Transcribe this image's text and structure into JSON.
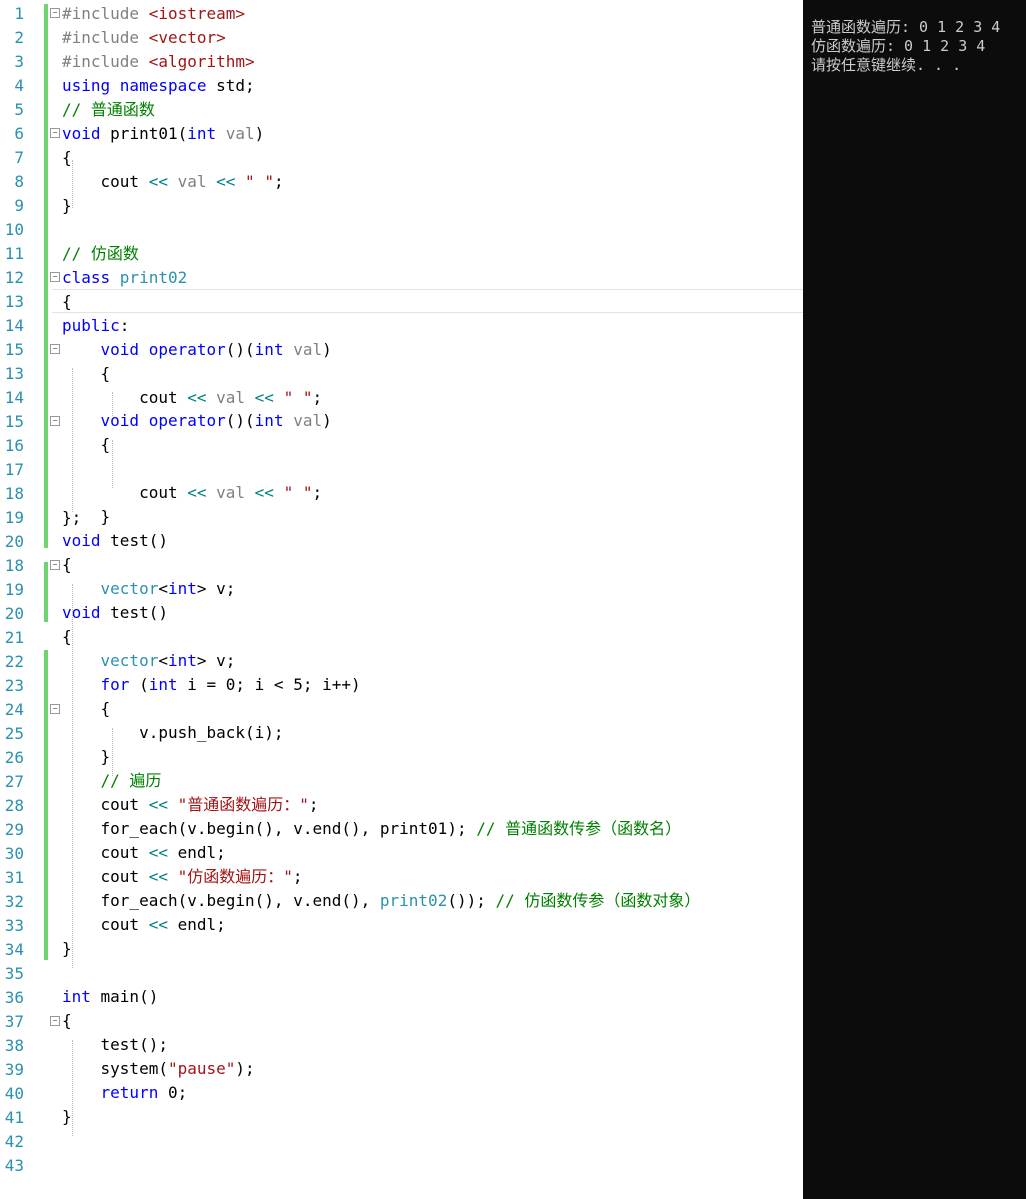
{
  "editor": {
    "lines": [
      {
        "n": "1",
        "segs": [
          {
            "t": "#include ",
            "c": "pp"
          },
          {
            "t": "<iostream>",
            "c": "str"
          }
        ]
      },
      {
        "n": "2",
        "segs": [
          {
            "t": "#include ",
            "c": "pp"
          },
          {
            "t": "<vector>",
            "c": "str"
          }
        ]
      },
      {
        "n": "3",
        "segs": [
          {
            "t": "#include ",
            "c": "pp"
          },
          {
            "t": "<algorithm>",
            "c": "str"
          }
        ]
      },
      {
        "n": "4",
        "segs": [
          {
            "t": "using namespace ",
            "c": "kw"
          },
          {
            "t": "std;",
            "c": ""
          }
        ]
      },
      {
        "n": "5",
        "segs": [
          {
            "t": "// 普通函数",
            "c": "cm"
          }
        ]
      },
      {
        "n": "6",
        "segs": [
          {
            "t": "void ",
            "c": "kw"
          },
          {
            "t": "print01(",
            "c": ""
          },
          {
            "t": "int ",
            "c": "kw"
          },
          {
            "t": "val",
            "c": "pa"
          },
          {
            "t": ")",
            "c": ""
          }
        ]
      },
      {
        "n": "7",
        "segs": [
          {
            "t": "{",
            "c": ""
          }
        ]
      },
      {
        "n": "8",
        "segs": [
          {
            "t": "    cout ",
            "c": ""
          },
          {
            "t": "<< ",
            "c": "op"
          },
          {
            "t": "val ",
            "c": "pa"
          },
          {
            "t": "<< ",
            "c": "op"
          },
          {
            "t": "\" \"",
            "c": "str"
          },
          {
            "t": ";",
            "c": ""
          }
        ]
      },
      {
        "n": "9",
        "segs": [
          {
            "t": "}",
            "c": ""
          }
        ]
      },
      {
        "n": "10",
        "segs": []
      },
      {
        "n": "11",
        "segs": [
          {
            "t": "// 仿函数",
            "c": "cm"
          }
        ]
      },
      {
        "n": "12",
        "segs": [
          {
            "t": "class ",
            "c": "kw"
          },
          {
            "t": "print02",
            "c": "ty"
          }
        ]
      },
      {
        "n": "13",
        "segs": [
          {
            "t": "{",
            "c": ""
          }
        ]
      },
      {
        "n": "14",
        "segs": [
          {
            "t": "public",
            "c": "kw"
          },
          {
            "t": ":",
            "c": ""
          }
        ]
      },
      {
        "n": "15",
        "segs": [
          {
            "t": "    ",
            "c": ""
          },
          {
            "t": "void ",
            "c": "kw"
          },
          {
            "t": "operator",
            "c": "kw"
          },
          {
            "t": "()(",
            "c": ""
          },
          {
            "t": "int ",
            "c": "kw"
          },
          {
            "t": "val",
            "c": "pa"
          },
          {
            "t": ")",
            "c": ""
          }
        ]
      },
      {
        "n": "13",
        "segs": [
          {
            "t": "    {",
            "c": ""
          }
        ]
      },
      {
        "n": "14",
        "segs": [
          {
            "t": "        cout ",
            "c": ""
          },
          {
            "t": "<< ",
            "c": "op"
          },
          {
            "t": "val ",
            "c": "pa"
          },
          {
            "t": "<< ",
            "c": "op"
          },
          {
            "t": "\" \"",
            "c": "str"
          },
          {
            "t": ";",
            "c": ""
          }
        ]
      },
      {
        "n": "15",
        "segs": [
          {
            "t": "    ",
            "c": ""
          },
          {
            "t": "void ",
            "c": "kw"
          },
          {
            "t": "operator",
            "c": "kw"
          },
          {
            "t": "()(",
            "c": ""
          },
          {
            "t": "int ",
            "c": "kw"
          },
          {
            "t": "val",
            "c": "pa"
          },
          {
            "t": ")",
            "c": ""
          }
        ]
      },
      {
        "n": "16",
        "segs": [
          {
            "t": "    {",
            "c": ""
          }
        ]
      },
      {
        "n": "17",
        "segs": [
          {
            "t": "        cout ",
            "c": ""
          },
          {
            "t": "<< ",
            "c": "op"
          },
          {
            "t": "val ",
            "c": "pa"
          },
          {
            "t": "<< ",
            "c": "op"
          },
          {
            "t": "\" \"",
            "c": "str"
          },
          {
            "t": ";",
            "c": ""
          }
        ]
      },
      {
        "n": "18",
        "segs": [
          {
            "t": "    }",
            "c": ""
          }
        ]
      },
      {
        "n": "19",
        "segs": [
          {
            "t": "};",
            "c": ""
          }
        ]
      },
      {
        "n": "20",
        "segs": []
      },
      {
        "n": "18",
        "segs": [
          {
            "t": "void ",
            "c": "kw"
          },
          {
            "t": "test()",
            "c": ""
          }
        ]
      },
      {
        "n": "19",
        "segs": [
          {
            "t": "{",
            "c": ""
          }
        ]
      },
      {
        "n": "20",
        "segs": [
          {
            "t": "    vector",
            "c": "ty"
          },
          {
            "t": "<",
            "c": ""
          },
          {
            "t": "int",
            "c": "kw"
          },
          {
            "t": "> v;",
            "c": ""
          }
        ]
      },
      {
        "n": "21",
        "segs": [
          {
            "t": "void ",
            "c": "kw"
          },
          {
            "t": "test()",
            "c": ""
          }
        ]
      },
      {
        "n": "22",
        "segs": [
          {
            "t": "{",
            "c": ""
          }
        ]
      },
      {
        "n": "23",
        "segs": [
          {
            "t": "    vector",
            "c": "ty"
          },
          {
            "t": "<",
            "c": ""
          },
          {
            "t": "int",
            "c": "kw"
          },
          {
            "t": "> v;",
            "c": ""
          }
        ]
      },
      {
        "n": "24",
        "segs": [
          {
            "t": "    for ",
            "c": "kw"
          },
          {
            "t": "(",
            "c": ""
          },
          {
            "t": "int ",
            "c": "kw"
          },
          {
            "t": "i = 0; i < 5; i++)",
            "c": ""
          }
        ]
      },
      {
        "n": "25",
        "segs": [
          {
            "t": "    {",
            "c": ""
          }
        ]
      },
      {
        "n": "26",
        "segs": [
          {
            "t": "        v.push_back(i);",
            "c": ""
          }
        ]
      },
      {
        "n": "27",
        "segs": [
          {
            "t": "    }",
            "c": ""
          }
        ]
      },
      {
        "n": "28",
        "segs": [
          {
            "t": "    // 遍历",
            "c": "cm"
          }
        ]
      },
      {
        "n": "29",
        "segs": [
          {
            "t": "    cout ",
            "c": ""
          },
          {
            "t": "<< ",
            "c": "op"
          },
          {
            "t": "\"普通函数遍历：\"",
            "c": "str"
          },
          {
            "t": ";",
            "c": ""
          }
        ]
      },
      {
        "n": "30",
        "segs": [
          {
            "t": "    for_each(v.begin(), v.end(), print01); ",
            "c": ""
          },
          {
            "t": "// 普通函数传参（函数名）",
            "c": "cm"
          }
        ]
      },
      {
        "n": "31",
        "segs": [
          {
            "t": "    cout ",
            "c": ""
          },
          {
            "t": "<< ",
            "c": "op"
          },
          {
            "t": "endl;",
            "c": ""
          }
        ]
      },
      {
        "n": "32",
        "segs": [
          {
            "t": "    cout ",
            "c": ""
          },
          {
            "t": "<< ",
            "c": "op"
          },
          {
            "t": "\"仿函数遍历：\"",
            "c": "str"
          },
          {
            "t": ";",
            "c": ""
          }
        ]
      },
      {
        "n": "33",
        "segs": [
          {
            "t": "    for_each(v.begin(), v.end(), ",
            "c": ""
          },
          {
            "t": "print02",
            "c": "ty"
          },
          {
            "t": "()); ",
            "c": ""
          },
          {
            "t": "// 仿函数传参（函数对象）",
            "c": "cm"
          }
        ]
      },
      {
        "n": "34",
        "segs": [
          {
            "t": "    cout ",
            "c": ""
          },
          {
            "t": "<< ",
            "c": "op"
          },
          {
            "t": "endl;",
            "c": ""
          }
        ]
      },
      {
        "n": "35",
        "segs": [
          {
            "t": "}",
            "c": ""
          }
        ]
      },
      {
        "n": "36",
        "segs": []
      },
      {
        "n": "37",
        "segs": [
          {
            "t": "int ",
            "c": "kw"
          },
          {
            "t": "main()",
            "c": ""
          }
        ]
      },
      {
        "n": "38",
        "segs": [
          {
            "t": "{",
            "c": ""
          }
        ]
      },
      {
        "n": "39",
        "segs": [
          {
            "t": "    test();",
            "c": ""
          }
        ]
      },
      {
        "n": "40",
        "segs": [
          {
            "t": "    system(",
            "c": ""
          },
          {
            "t": "\"pause\"",
            "c": "str"
          },
          {
            "t": ");",
            "c": ""
          }
        ]
      },
      {
        "n": "41",
        "segs": [
          {
            "t": "    return ",
            "c": "kw"
          },
          {
            "t": "0;",
            "c": ""
          }
        ]
      },
      {
        "n": "42",
        "segs": [
          {
            "t": "}",
            "c": ""
          }
        ]
      },
      {
        "n": "43",
        "segs": []
      }
    ]
  },
  "console": {
    "lines": [
      "普通函数遍历: 0 1 2 3 4",
      "仿函数遍历: 0 1 2 3 4",
      "请按任意键继续. . ."
    ]
  },
  "colors": {
    "keyword": "#0000ff",
    "type": "#2b91af",
    "string": "#a31515",
    "comment": "#008000",
    "preprocessor": "#808080",
    "operator": "#008080",
    "line_number": "#2b91af",
    "change_bar": "#6fd36f",
    "console_bg": "#0c0c0c",
    "console_text": "#cccccc"
  }
}
